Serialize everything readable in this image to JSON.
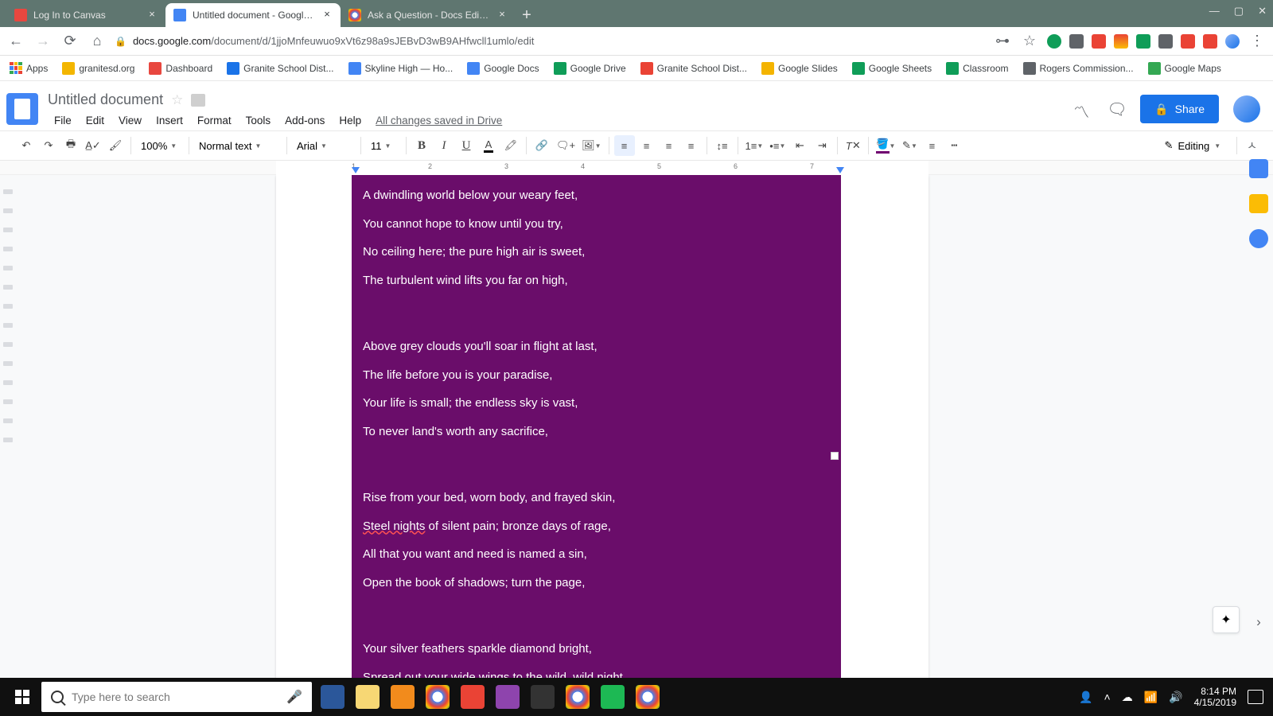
{
  "tabs": [
    {
      "title": "Log In to Canvas",
      "active": false,
      "iconColor": "#e8473f"
    },
    {
      "title": "Untitled document - Google Docs",
      "active": true,
      "iconColor": "#4285f4"
    },
    {
      "title": "Ask a Question - Docs Editors Help",
      "active": false,
      "iconColor": "#4285f4"
    }
  ],
  "url": {
    "host": "docs.google.com",
    "path": "/document/d/1jjoMnfeuwuo9xVt6z98a9sJEBvD3wB9AHfwcll1umlo/edit"
  },
  "bookmarks": [
    {
      "label": "Apps",
      "color": "linear-gradient(45deg,#ea4335,#fbbc05,#34a853,#4285f4)"
    },
    {
      "label": "granitesd.org",
      "color": "#f3b600"
    },
    {
      "label": "Dashboard",
      "color": "#e8473f"
    },
    {
      "label": "Granite School Dist...",
      "color": "#1a73e8"
    },
    {
      "label": "Skyline High — Ho...",
      "color": "#4285f4"
    },
    {
      "label": "Google Docs",
      "color": "#4285f4"
    },
    {
      "label": "Google Drive",
      "color": "#0f9d58"
    },
    {
      "label": "Granite School Dist...",
      "color": "#ea4335"
    },
    {
      "label": "Google Slides",
      "color": "#f4b400"
    },
    {
      "label": "Google Sheets",
      "color": "#0f9d58"
    },
    {
      "label": "Classroom",
      "color": "#0f9d58"
    },
    {
      "label": "Rogers Commission...",
      "color": "#5f6368"
    },
    {
      "label": "Google Maps",
      "color": "#34a853"
    }
  ],
  "doc": {
    "title": "Untitled document",
    "saveStatus": "All changes saved in Drive"
  },
  "menus": [
    "File",
    "Edit",
    "View",
    "Insert",
    "Format",
    "Tools",
    "Add-ons",
    "Help"
  ],
  "share": "Share",
  "toolbar": {
    "zoom": "100%",
    "styles": "Normal text",
    "font": "Arial",
    "size": "11",
    "editing": "Editing"
  },
  "ruler": [
    "1",
    "2",
    "3",
    "4",
    "5",
    "6",
    "7"
  ],
  "poem": {
    "stanza1": [
      "A dwindling world below your weary feet,",
      "You cannot hope to know until you try,",
      "No ceiling here; the pure high air is sweet,",
      "The turbulent wind lifts you far on high,"
    ],
    "stanza2": [
      "Above grey clouds you'll soar in flight at last,",
      "The life before you is your paradise,",
      "Your life is small; the endless sky is vast,",
      "To never land's worth any sacrifice,"
    ],
    "stanza3": [
      "Rise from your bed, worn body, and frayed skin,",
      "Steel nights of silent pain; bronze days of rage,",
      "All that you want and need is named a sin,",
      "Open the book of shadows; turn the page,"
    ],
    "stanza4": [
      "Your silver feathers sparkle diamond bright,",
      "Spread out your wide wings to the wild, wild night."
    ]
  },
  "taskbar": {
    "searchPlaceholder": "Type here to search",
    "apps": [
      {
        "name": "word",
        "color": "#2b579a"
      },
      {
        "name": "file-explorer",
        "color": "#f7d774"
      },
      {
        "name": "outlook",
        "color": "#f28b1c"
      },
      {
        "name": "chrome-1",
        "color": "radial-gradient(circle,#fff 30%,#4285f4 31%,#ea4335 60%,#fbbc05 80%,#34a853)"
      },
      {
        "name": "chrome-canary",
        "color": "#ea4335"
      },
      {
        "name": "snip",
        "color": "#8e44ad"
      },
      {
        "name": "calculator",
        "color": "#333"
      },
      {
        "name": "chrome-2",
        "color": "radial-gradient(circle,#fff 30%,#4285f4 31%,#ea4335 60%,#fbbc05 80%,#34a853)"
      },
      {
        "name": "spotify",
        "color": "#1db954"
      },
      {
        "name": "chrome-active",
        "color": "radial-gradient(circle,#fff 30%,#4285f4 31%,#ea4335 60%,#fbbc05 80%,#34a853)"
      }
    ],
    "time": "8:14 PM",
    "date": "4/15/2019"
  }
}
